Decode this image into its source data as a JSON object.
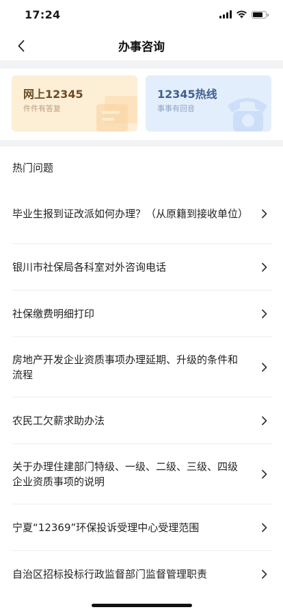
{
  "status": {
    "time": "17:24",
    "battery_level": 0.75
  },
  "nav": {
    "back_icon": "chevron-left-icon",
    "title": "办事咨询"
  },
  "cards": [
    {
      "title": "网上12345",
      "subtitle": "件件有答复",
      "icon": "document-icon",
      "background": "#fdeed6",
      "accent": "#6b4c24"
    },
    {
      "title": "12345热线",
      "subtitle": "事事有回音",
      "icon": "telephone-icon",
      "background": "#e3eefc",
      "accent": "#3f5f8c"
    }
  ],
  "hot_questions": {
    "title": "热门问题",
    "items": [
      {
        "text": "毕业生报到证改派如何办理？（从原籍到接收单位）"
      },
      {
        "text": "银川市社保局各科室对外咨询电话"
      },
      {
        "text": "社保缴费明细打印"
      },
      {
        "text": "房地产开发企业资质事项办理延期、升级的条件和流程"
      },
      {
        "text": "农民工欠薪求助办法"
      },
      {
        "text": "关于办理住建部门特级、一级、二级、三级、四级企业资质事项的说明"
      },
      {
        "text": "宁夏“12369”环保投诉受理中心受理范围"
      },
      {
        "text": "自治区招标投标行政监督部门监督管理职责"
      }
    ]
  }
}
